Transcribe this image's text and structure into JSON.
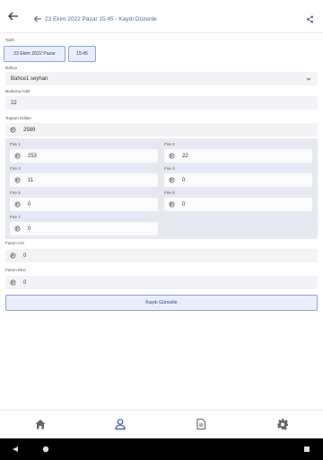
{
  "header": {
    "title": "23 Ekim 2022 Pazar 15:45 - Kaydı Düzenle"
  },
  "form": {
    "tarih_label": "Tarih",
    "date_value": "23 Ekim 2022 Pazar",
    "time_value": "15:45",
    "bahce_label": "Bahçe",
    "bahce_value": "Bahce1 seyhan",
    "budama_label": "Budama Adet",
    "budama_value": "22",
    "toplam_label": "Toplam Edilen",
    "toplam_value": "2589",
    "fires": [
      {
        "label": "Fire 1",
        "value": "253"
      },
      {
        "label": "Fire 2",
        "value": "22"
      },
      {
        "label": "Fire 3",
        "value": "11"
      },
      {
        "label": "Fire 4",
        "value": "0"
      },
      {
        "label": "Fire 5",
        "value": "0"
      },
      {
        "label": "Fire 6",
        "value": "0"
      },
      {
        "label": "Fire 7",
        "value": "0"
      }
    ],
    "fason_arti_label": "Fason Artı",
    "fason_arti_value": "0",
    "fason_eksi_label": "Fason Eksi",
    "fason_eksi_value": "0",
    "update_label": "Kaydı Güncelle"
  },
  "icons": {
    "back": "arrow-left-icon",
    "share": "share-icon",
    "field": "coin-icon",
    "tabs": [
      "home-icon",
      "user-icon",
      "document-icon",
      "gear-icon"
    ]
  },
  "colors": {
    "accent": "#5468a4",
    "button_bg": "#e9eefb",
    "button_border": "#8ea3d8",
    "panel_bg": "#e6e9f1"
  }
}
